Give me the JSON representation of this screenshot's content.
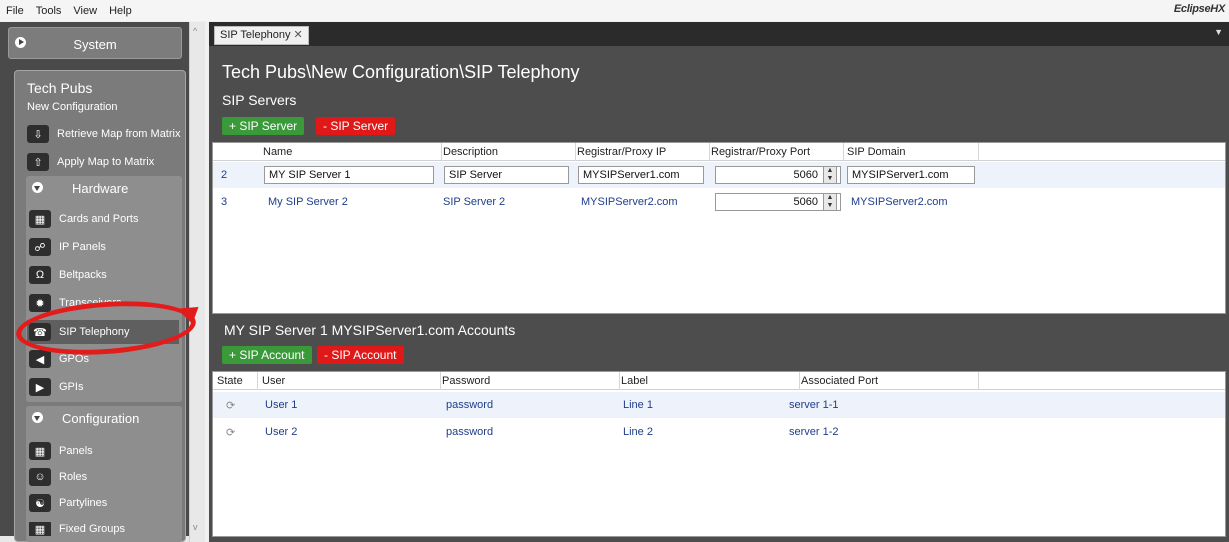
{
  "menu": {
    "file": "File",
    "tools": "Tools",
    "view": "View",
    "help": "Help",
    "brand": "EclipseHX"
  },
  "sidebar": {
    "system_label": "System",
    "project_title": "Tech Pubs",
    "project_sub": "New Configuration",
    "retrieve": "Retrieve Map from Matrix",
    "apply": "Apply Map to Matrix",
    "hardware": "Hardware",
    "hardware_items": [
      {
        "label": "Cards and Ports",
        "icon": "cards-icon"
      },
      {
        "label": "IP Panels",
        "icon": "ip-panel-icon"
      },
      {
        "label": "Beltpacks",
        "icon": "headset-icon"
      },
      {
        "label": "Transceivers",
        "icon": "antenna-icon"
      },
      {
        "label": "SIP Telephony",
        "icon": "phone-icon"
      },
      {
        "label": "GPOs",
        "icon": "gpo-icon"
      },
      {
        "label": "GPIs",
        "icon": "gpi-icon"
      }
    ],
    "configuration": "Configuration",
    "config_items": [
      {
        "label": "Panels",
        "icon": "keypad-icon"
      },
      {
        "label": "Roles",
        "icon": "roles-icon"
      },
      {
        "label": "Partylines",
        "icon": "partyline-icon"
      },
      {
        "label": "Fixed Groups",
        "icon": "group-icon"
      }
    ]
  },
  "tab": {
    "label": "SIP Telephony"
  },
  "page": {
    "breadcrumb": "Tech Pubs\\New Configuration\\SIP Telephony"
  },
  "servers": {
    "title": "SIP Servers",
    "add": "+ SIP Server",
    "remove": "- SIP Server",
    "columns": [
      "Name",
      "Description",
      "Registrar/Proxy IP",
      "Registrar/Proxy Port",
      "SIP Domain"
    ],
    "rows": [
      {
        "id": "2",
        "name": "MY SIP Server 1",
        "description": "SIP Server",
        "ip": "MYSIPServer1.com",
        "port": "5060",
        "domain": "MYSIPServer1.com"
      },
      {
        "id": "3",
        "name": "My SIP Server 2",
        "description": "SIP Server 2",
        "ip": "MYSIPServer2.com",
        "port": "5060",
        "domain": "MYSIPServer2.com"
      }
    ]
  },
  "accounts": {
    "title": "MY SIP Server 1 MYSIPServer1.com Accounts",
    "add": "+ SIP Account",
    "remove": "- SIP Account",
    "columns": [
      "State",
      "User",
      "Password",
      "Label",
      "Associated Port"
    ],
    "rows": [
      {
        "state_icon": "sync-icon",
        "user": "User 1",
        "password": "password",
        "label": "Line 1",
        "port": "server 1-1"
      },
      {
        "state_icon": "sync-icon",
        "user": "User 2",
        "password": "password",
        "label": "Line 2",
        "port": "server 1-2"
      }
    ]
  }
}
